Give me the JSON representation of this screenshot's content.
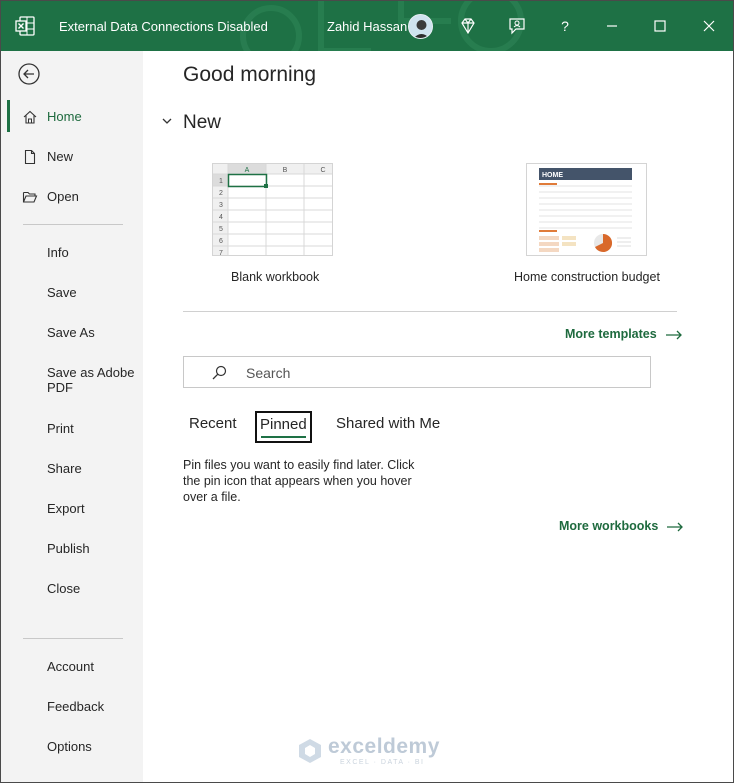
{
  "titlebar": {
    "title": "External Data Connections Disabled",
    "user_name": "Zahid Hassan",
    "help_label": "?",
    "icons": [
      "excel-icon",
      "diamond-icon",
      "feedback-icon",
      "help-icon",
      "minimize-icon",
      "maximize-icon",
      "close-icon"
    ],
    "accent_color": "#1e7145"
  },
  "sidebar": {
    "items": [
      {
        "label": "Home",
        "icon": "home-icon",
        "active": true
      },
      {
        "label": "New",
        "icon": "new-document-icon"
      },
      {
        "label": "Open",
        "icon": "folder-open-icon"
      },
      {
        "label": "Info"
      },
      {
        "label": "Save"
      },
      {
        "label": "Save As"
      },
      {
        "label": "Save as Adobe PDF"
      },
      {
        "label": "Print"
      },
      {
        "label": "Share"
      },
      {
        "label": "Export"
      },
      {
        "label": "Publish"
      },
      {
        "label": "Close"
      },
      {
        "label": "Account"
      },
      {
        "label": "Feedback"
      },
      {
        "label": "Options"
      }
    ]
  },
  "main": {
    "greeting": "Good morning",
    "new_section": "New",
    "templates": [
      {
        "label": "Blank workbook",
        "columns": [
          "A",
          "B",
          "C"
        ],
        "rows": [
          "1",
          "2",
          "3",
          "4",
          "5",
          "6",
          "7"
        ]
      },
      {
        "label": "Home construction budget",
        "thumb_title": "HOME"
      }
    ],
    "more_templates": "More templates",
    "search_placeholder": "Search",
    "tabs": [
      {
        "label": "Recent"
      },
      {
        "label": "Pinned",
        "selected": true
      },
      {
        "label": "Shared with Me"
      }
    ],
    "pinned_message": "Pin files you want to easily find later. Click the pin icon that appears when you hover over a file.",
    "more_workbooks": "More workbooks"
  },
  "watermark": {
    "brand": "exceldemy",
    "tagline": "EXCEL · DATA · BI"
  }
}
